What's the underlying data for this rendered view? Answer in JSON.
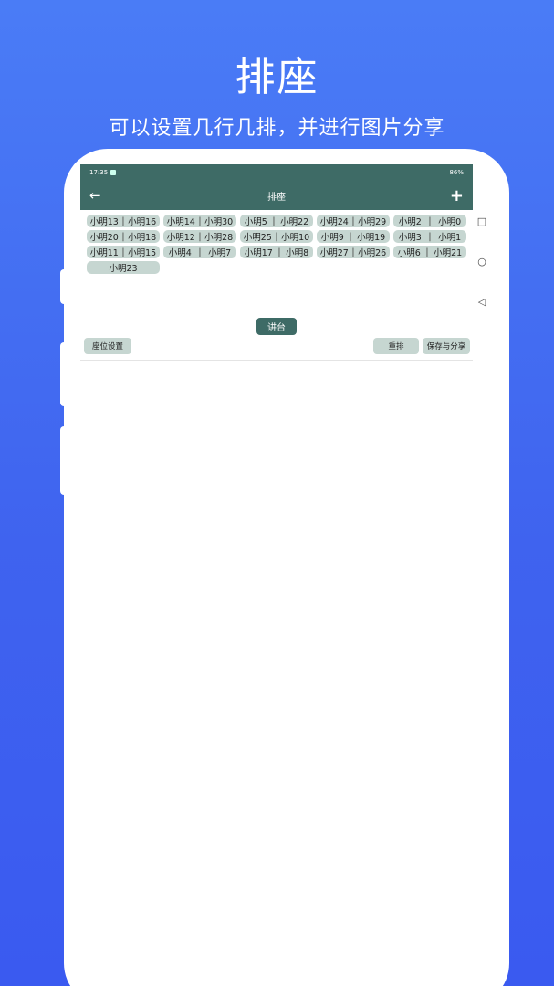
{
  "promo": {
    "title": "排座",
    "subtitle": "可以设置几行几排，并进行图片分享"
  },
  "statusbar": {
    "time": "17:35",
    "battery": "86%"
  },
  "appbar": {
    "back_icon": "←",
    "title": "排座",
    "add_icon": "+"
  },
  "seats": [
    [
      [
        "小明13",
        "小明16"
      ],
      [
        "小明14",
        "小明30"
      ],
      [
        "小明5",
        "小明22"
      ],
      [
        "小明24",
        "小明29"
      ],
      [
        "小明2",
        "小明0"
      ]
    ],
    [
      [
        "小明20",
        "小明18"
      ],
      [
        "小明12",
        "小明28"
      ],
      [
        "小明25",
        "小明10"
      ],
      [
        "小明9",
        "小明19"
      ],
      [
        "小明3",
        "小明1"
      ]
    ],
    [
      [
        "小明11",
        "小明15"
      ],
      [
        "小明4",
        "小明7"
      ],
      [
        "小明17",
        "小明8"
      ],
      [
        "小明27",
        "小明26"
      ],
      [
        "小明6",
        "小明21"
      ]
    ],
    [
      [
        "小明23"
      ]
    ]
  ],
  "podium_label": "讲台",
  "buttons": {
    "seat_settings": "座位设置",
    "rearrange": "重排",
    "save_share": "保存与分享"
  },
  "nav": {
    "recent_icon": "□",
    "home_icon": "○",
    "back_icon": "◁"
  },
  "colors": {
    "bg_gradient_top": "#4a7cf6",
    "bg_gradient_bottom": "#3a5af0",
    "appbar": "#3e6b66",
    "seat": "#c6d6d1"
  }
}
